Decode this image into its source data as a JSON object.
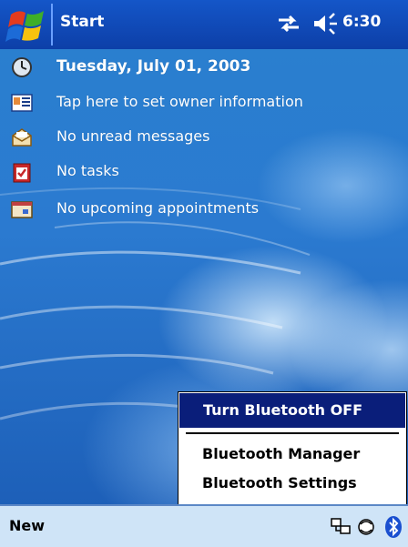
{
  "topbar": {
    "start_label": "Start",
    "time": "6:30"
  },
  "today": {
    "items": [
      {
        "icon": "clock-icon",
        "text": "Tuesday, July 01, 2003"
      },
      {
        "icon": "owner-card-icon",
        "text": "Tap here to set owner information"
      },
      {
        "icon": "envelope-icon",
        "text": "No unread messages"
      },
      {
        "icon": "tasks-clipboard-icon",
        "text": "No tasks"
      },
      {
        "icon": "calendar-icon",
        "text": "No upcoming appointments"
      }
    ]
  },
  "bt_menu": {
    "items": [
      "Turn Bluetooth OFF",
      "Bluetooth Manager",
      "Bluetooth Settings"
    ]
  },
  "bottombar": {
    "new_label": "New"
  },
  "colors": {
    "accent": "#0a1e7a",
    "topbar": "#1456c8",
    "bottombar": "#cfe4f7"
  }
}
